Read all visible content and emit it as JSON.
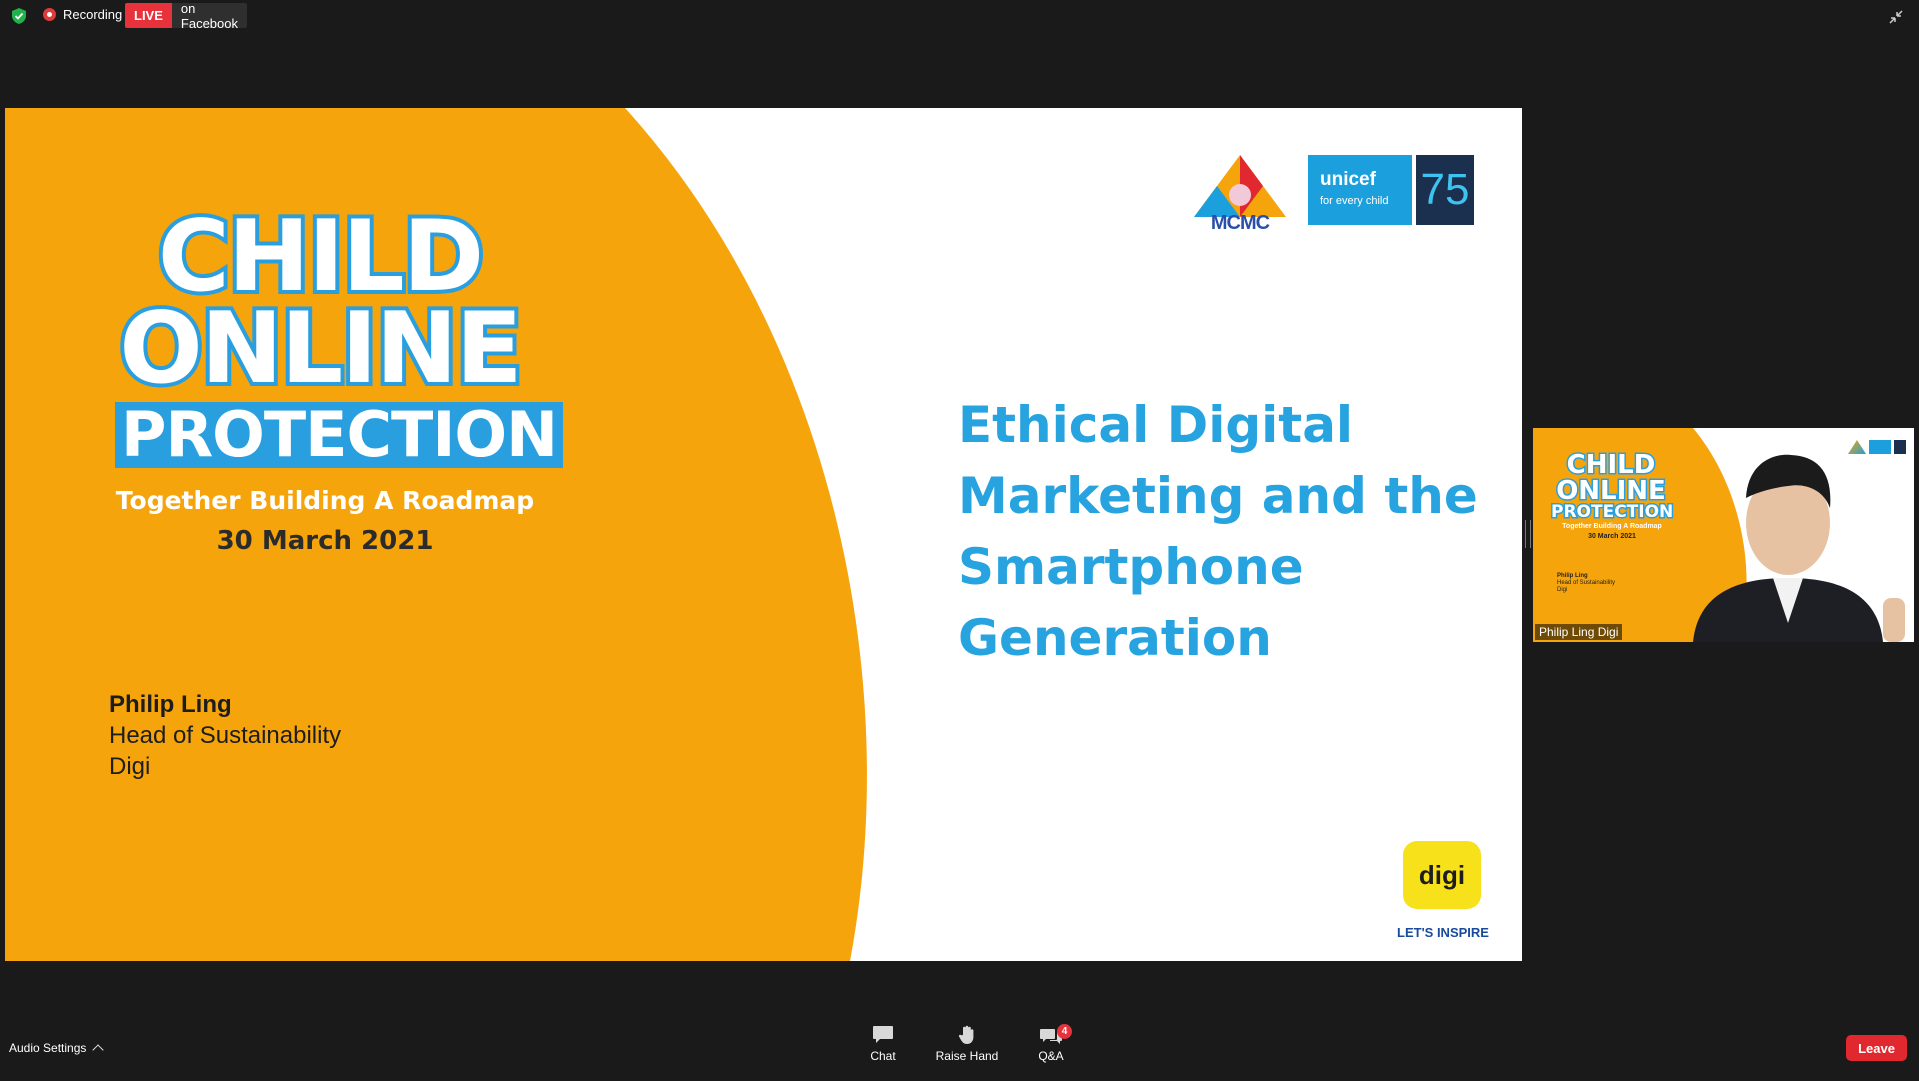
{
  "topbar": {
    "recording_label": "Recording",
    "live_badge": "LIVE",
    "live_destination": "on Facebook"
  },
  "slide": {
    "event_title_line1": "CHILD",
    "event_title_line2": "ONLINE",
    "event_title_line3": "PROTECTION",
    "event_subtitle": "Together Building A Roadmap",
    "event_date": "30 March 2021",
    "speaker_name": "Philip Ling",
    "speaker_role": "Head of Sustainability",
    "speaker_org": "Digi",
    "talk_title": "Ethical Digital Marketing and the Smartphone Generation",
    "logo_mcmc": "MCMC",
    "logo_unicef": "unicef",
    "logo_unicef_tagline": "for every child",
    "logo_75": "75",
    "logo_digi": "digi",
    "digi_tagline": "LET'S INSPIRE"
  },
  "video": {
    "participant_name": "Philip Ling Digi"
  },
  "bottombar": {
    "audio_settings": "Audio Settings",
    "chat_label": "Chat",
    "raise_hand_label": "Raise Hand",
    "qa_label": "Q&A",
    "qa_badge_count": "4",
    "leave_label": "Leave"
  },
  "colors": {
    "slide_orange": "#f5a40c",
    "title_blue": "#27a3df",
    "live_red": "#e8323b",
    "leave_red": "#e0282e",
    "digi_yellow": "#f7e11b"
  }
}
